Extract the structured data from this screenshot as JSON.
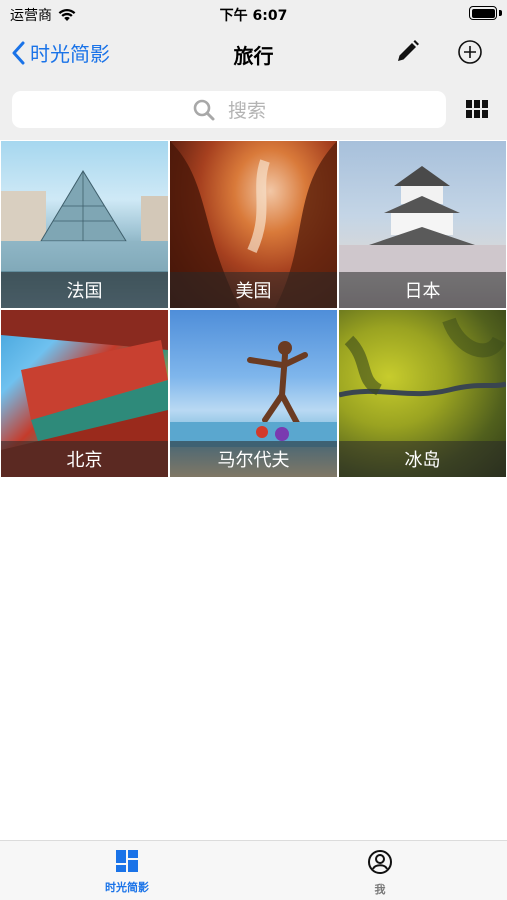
{
  "status_bar": {
    "carrier": "运营商",
    "time": "下午 6:07",
    "battery_level": 1.0
  },
  "nav": {
    "back_label": "时光简影",
    "title": "旅行",
    "icons": {
      "back": "chevron-left-icon",
      "edit": "pencil-icon",
      "add": "plus-circle-icon"
    }
  },
  "search": {
    "placeholder": "搜索",
    "icons": {
      "search": "magnifier-icon",
      "layout": "grid-view-icon"
    }
  },
  "albums": [
    {
      "label": "法国"
    },
    {
      "label": "美国"
    },
    {
      "label": "日本"
    },
    {
      "label": "北京"
    },
    {
      "label": "马尔代夫"
    },
    {
      "label": "冰岛"
    }
  ],
  "tab_bar": {
    "tabs": [
      {
        "label": "时光简影",
        "icon": "dashboard-icon",
        "selected": true
      },
      {
        "label": "我",
        "icon": "user-circle-icon",
        "selected": false
      }
    ]
  },
  "colors": {
    "accent": "#1a73e8",
    "inactive": "#7a7a7a",
    "background": "#efefef"
  }
}
